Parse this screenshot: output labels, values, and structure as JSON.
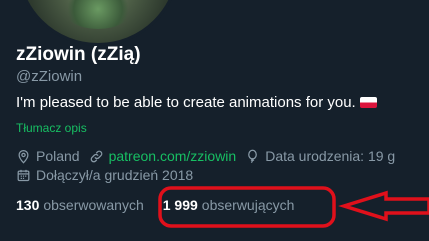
{
  "profile": {
    "display_name": "zZiowin (zZią)",
    "handle": "@zZiowin",
    "bio": "I'm pleased to be able to create animations for you.",
    "bio_emoji": "flag-poland-icon",
    "translate_label": "Tłumacz opis",
    "location": "Poland",
    "website": "patreon.com/zziowin",
    "birth": "Data urodzenia: 19 g",
    "joined": "Dołączył/a grudzień 2018",
    "following_count": "130",
    "following_label": "obserwowanych",
    "followers_count": "1 999",
    "followers_label": "obserwujących"
  },
  "colors": {
    "background": "#15202b",
    "muted_text": "#8899a6",
    "link": "#17bf63",
    "annotation_red": "#e0101b"
  }
}
